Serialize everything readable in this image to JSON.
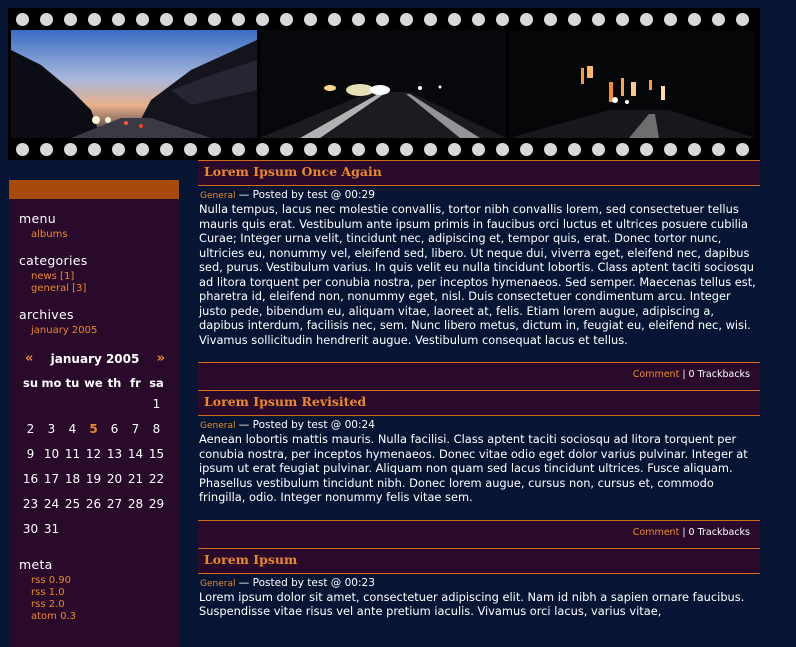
{
  "header": {
    "frames": [
      "dusk-road-photo",
      "night-road-lights-photo",
      "night-street-signs-photo"
    ]
  },
  "sidebar": {
    "menu": {
      "title": "menu",
      "items": [
        "albums"
      ]
    },
    "categories": {
      "title": "categories",
      "items": [
        "news [1]",
        "general [3]"
      ]
    },
    "archives": {
      "title": "archives",
      "items": [
        "january 2005"
      ]
    },
    "calendar": {
      "prev": "«",
      "next": "»",
      "month": "january 2005",
      "weekdays": [
        "su",
        "mo",
        "tu",
        "we",
        "th",
        "fr",
        "sa"
      ],
      "weeks": [
        [
          "",
          "",
          "",
          "",
          "",
          "",
          "1"
        ],
        [
          "2",
          "3",
          "4",
          "5",
          "6",
          "7",
          "8"
        ],
        [
          "9",
          "10",
          "11",
          "12",
          "13",
          "14",
          "15"
        ],
        [
          "16",
          "17",
          "18",
          "19",
          "20",
          "21",
          "22"
        ],
        [
          "23",
          "24",
          "25",
          "26",
          "27",
          "28",
          "29"
        ],
        [
          "30",
          "31",
          "",
          "",
          "",
          "",
          ""
        ]
      ],
      "highlighted_day": "5"
    },
    "meta": {
      "title": "meta",
      "items": [
        "rss 0.90",
        "rss 1.0",
        "rss 2.0",
        "atom 0.3"
      ]
    }
  },
  "posts": [
    {
      "title": "Lorem Ipsum Once Again",
      "category": "General",
      "byline": " — Posted by test @ 00:29",
      "body": "Nulla tempus, lacus nec molestie convallis, tortor nibh convallis lorem, sed consectetuer tellus mauris quis erat. Vestibulum ante ipsum primis in faucibus orci luctus et ultrices posuere cubilia Curae; Integer urna velit, tincidunt nec, adipiscing et, tempor quis, erat. Donec tortor nunc, ultricies eu, nonummy vel, eleifend sed, libero. Ut neque dui, viverra eget, eleifend nec, dapibus sed, purus. Vestibulum varius. In quis velit eu nulla tincidunt lobortis. Class aptent taciti sociosqu ad litora torquent per conubia nostra, per inceptos hymenaeos. Sed semper. Maecenas tellus est, pharetra id, eleifend non, nonummy eget, nisl. Duis consectetuer condimentum arcu. Integer justo pede, bibendum eu, aliquam vitae, laoreet at, felis. Etiam lorem augue, adipiscing a, dapibus interdum, facilisis nec, sem. Nunc libero metus, dictum in, feugiat eu, eleifend nec, wisi. Vivamus sollicitudin hendrerit augue. Vestibulum consequat lacus et tellus.",
      "comment": "Comment",
      "sep": " | ",
      "trackbacks": "0 Trackbacks"
    },
    {
      "title": "Lorem Ipsum Revisited",
      "category": "General",
      "byline": " — Posted by test @ 00:24",
      "body": "Aenean lobortis mattis mauris. Nulla facilisi. Class aptent taciti sociosqu ad litora torquent per conubia nostra, per inceptos hymenaeos. Donec vitae odio eget dolor varius pulvinar. Integer at ipsum ut erat feugiat pulvinar. Aliquam non quam sed lacus tincidunt ultrices. Fusce aliquam. Phasellus vestibulum tincidunt nibh. Donec lorem augue, cursus non, cursus et, commodo fringilla, odio. Integer nonummy felis vitae sem.",
      "comment": "Comment",
      "sep": " | ",
      "trackbacks": "0 Trackbacks"
    },
    {
      "title": "Lorem Ipsum",
      "category": "General",
      "byline": " — Posted by test @ 00:23",
      "body": "Lorem ipsum dolor sit amet, consectetuer adipiscing elit. Nam id nibh a sapien ornare faucibus. Suspendisse vitae risus vel ante pretium iaculis. Vivamus orci lacus, varius vitae,"
    }
  ],
  "colors": {
    "background": "#071535",
    "panel": "#2a0a2a",
    "accent": "#e88a2a",
    "sidebar_bar": "#a84a0a"
  }
}
